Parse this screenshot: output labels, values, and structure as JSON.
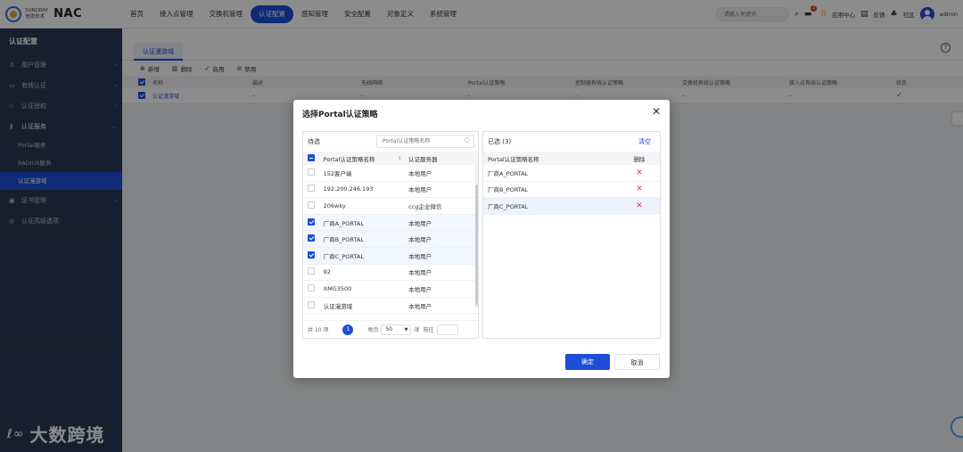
{
  "brand": {
    "logo_line1": "SUNDRAY",
    "logo_line2": "信锐技术",
    "product": "NAC"
  },
  "nav": {
    "items": [
      "首页",
      "接入点管理",
      "交换机管理",
      "认证配置",
      "感知管理",
      "安全配置",
      "对象定义",
      "系统管理"
    ],
    "active_index": 3
  },
  "topright": {
    "search_placeholder": "请输入关键词",
    "badge_count": "2",
    "app_center": "应用中心",
    "feedback": "反馈",
    "community": "社区",
    "user": "admin"
  },
  "sidebar": {
    "title": "认证配置",
    "items": [
      {
        "label": "用户管理",
        "icon": "user-icon",
        "glyph": "♙"
      },
      {
        "label": "有线认证",
        "icon": "ethernet-icon",
        "glyph": "▭"
      },
      {
        "label": "认证授权",
        "icon": "auth-user-icon",
        "glyph": "♘"
      },
      {
        "label": "认证服务",
        "icon": "key-user-icon",
        "glyph": "⚷"
      }
    ],
    "subitems": [
      "Portal服务",
      "RADIUS服务",
      "认证漫游域"
    ],
    "active_sub": "认证漫游域",
    "items_after": [
      {
        "label": "证书管理",
        "icon": "certificate-icon",
        "glyph": "▣"
      },
      {
        "label": "认证高级选项",
        "icon": "advanced-icon",
        "glyph": "◎"
      }
    ],
    "watermark": "大数跨境",
    "watermark_mark": "ℓ∞"
  },
  "content": {
    "tab": "认证漫游域",
    "toolbar": {
      "add": "新增",
      "delete": "删除",
      "enable": "启用",
      "disable": "禁用"
    },
    "table": {
      "columns": [
        "名称",
        "描述",
        "无线网络",
        "Portal认证策略",
        "控制器有线认证策略",
        "交换机有线认证策略",
        "接入点有线认证策略",
        "状态"
      ],
      "row": {
        "name": "认证漫游域",
        "desc": "-",
        "wifi": "-",
        "portal": "-",
        "ctrl": "-",
        "switch": "-",
        "ap": "-"
      }
    }
  },
  "modal": {
    "title": "选择Portal认证策略",
    "left": {
      "title": "待选",
      "search_placeholder": "Portal认证策略名称",
      "col_name": "Portal认证策略名称",
      "col_server": "认证服务器",
      "rows": [
        {
          "name": "152客户端",
          "server": "本地用户",
          "checked": false
        },
        {
          "name": "192.200.246.193",
          "server": "本地用户",
          "checked": false
        },
        {
          "name": "206wky",
          "server": "ccg企业微信",
          "checked": false
        },
        {
          "name": "厂商A_PORTAL",
          "server": "本地用户",
          "checked": true
        },
        {
          "name": "厂商B_PORTAL",
          "server": "本地用户",
          "checked": true
        },
        {
          "name": "厂商C_PORTAL",
          "server": "本地用户",
          "checked": true
        },
        {
          "name": "92",
          "server": "本地用户",
          "checked": false
        },
        {
          "name": "XMG3500",
          "server": "本地用户",
          "checked": false
        },
        {
          "name": "认证漫游域",
          "server": "本地用户",
          "checked": false
        }
      ],
      "pager": {
        "total": "共 10 项",
        "page": "1",
        "per_page_label": "每页",
        "per_page": "50",
        "unit": "项",
        "goto": "前往"
      }
    },
    "right": {
      "title": "已选 (3)",
      "clear": "清空",
      "col_name": "Portal认证策略名称",
      "col_del": "删除",
      "rows": [
        "厂商A_PORTAL",
        "厂商B_PORTAL",
        "厂商C_PORTAL"
      ]
    },
    "ok": "确定",
    "cancel": "取消"
  }
}
